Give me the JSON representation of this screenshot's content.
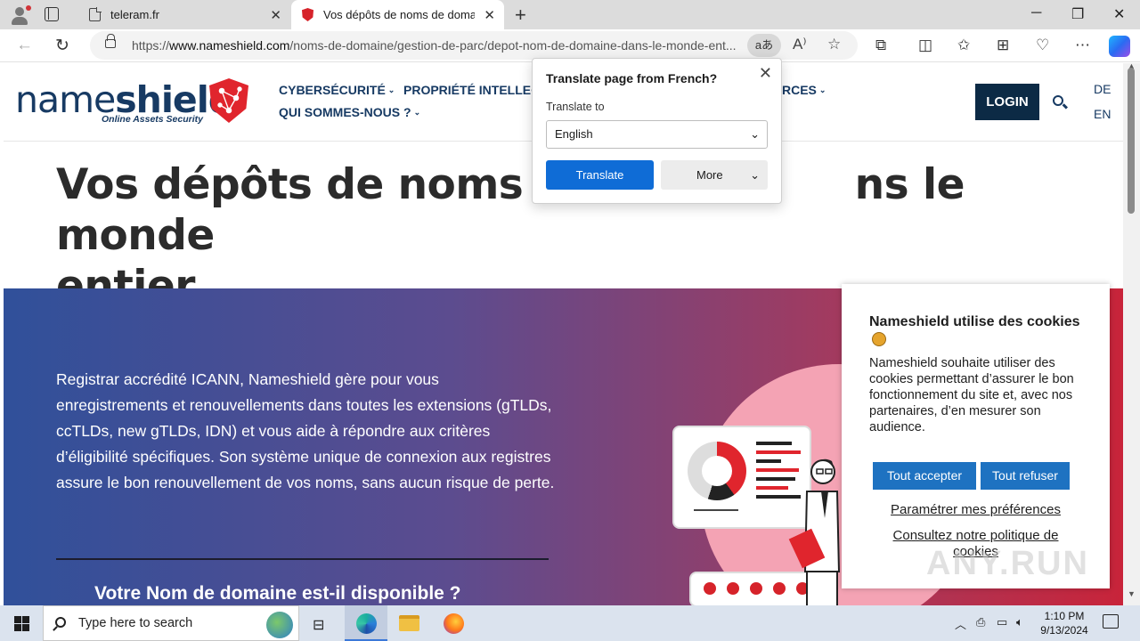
{
  "browser": {
    "tabs": [
      {
        "title": "teleram.fr",
        "close": "✕"
      },
      {
        "title": "Vos dépôts de noms de domaine",
        "close": "✕"
      }
    ],
    "new_tab": "+",
    "window_controls": {
      "minimize": "─",
      "maximize": "❐",
      "close": "✕"
    },
    "url_prefix": "https://",
    "url_host": "www.nameshield.com",
    "url_path": "/noms-de-domaine/gestion-de-parc/depot-nom-de-domaine-dans-le-monde-ent...",
    "translate_pill": "aあ"
  },
  "translate_popup": {
    "title": "Translate page from French?",
    "label": "Translate to",
    "language": "English",
    "translate_btn": "Translate",
    "more_btn": "More"
  },
  "site": {
    "logo_name_light": "name",
    "logo_name_bold": "shield",
    "logo_tagline": "Online Assets Security",
    "menu": {
      "cyber": "CYBERSÉCURITÉ",
      "propriete": "PROPRIÉTÉ INTELLECT",
      "rces": "RCES",
      "qui": "QUI SOMMES-NOUS ?"
    },
    "login": "LOGIN",
    "lang_de": "DE",
    "lang_en": "EN",
    "heading": "Vos dépôts de noms de domaine dans le monde entier",
    "heading_visible_left": "Vos dépôts de noms de d",
    "heading_visible_right": "ns le monde",
    "heading_line2": "entier",
    "hero_text": "Registrar accrédité ICANN, Nameshield gère pour vous enregistrements et renouvellements dans toutes les extensions (gTLDs, ccTLDs, new gTLDs, IDN) et vous aide à répondre aux critères d’éligibilité spécifiques. Son système unique de connexion aux registres assure le bon renouvellement de vos noms, sans aucun risque de perte.",
    "hero_sub": "Votre Nom de domaine est-il disponible ?"
  },
  "cookie": {
    "title": "Nameshield utilise des cookies",
    "body": "Nameshield souhaite utiliser des cookies permettant d’assurer le bon fonctionnement du site et, avec nos partenaires, d’en mesurer son audience.",
    "accept": "Tout accepter",
    "refuse": "Tout refuser",
    "prefs": "Paramétrer mes préférences",
    "policy": "Consultez notre politique de cookies"
  },
  "watermark": "ANY.RUN",
  "taskbar": {
    "search_placeholder": "Type here to search",
    "time": "1:10 PM",
    "date": "9/13/2024"
  },
  "colors": {
    "brand_navy": "#173a63",
    "brand_red": "#e0252d",
    "cookie_button": "#1e72c1",
    "translate_button": "#0f6cd6"
  }
}
